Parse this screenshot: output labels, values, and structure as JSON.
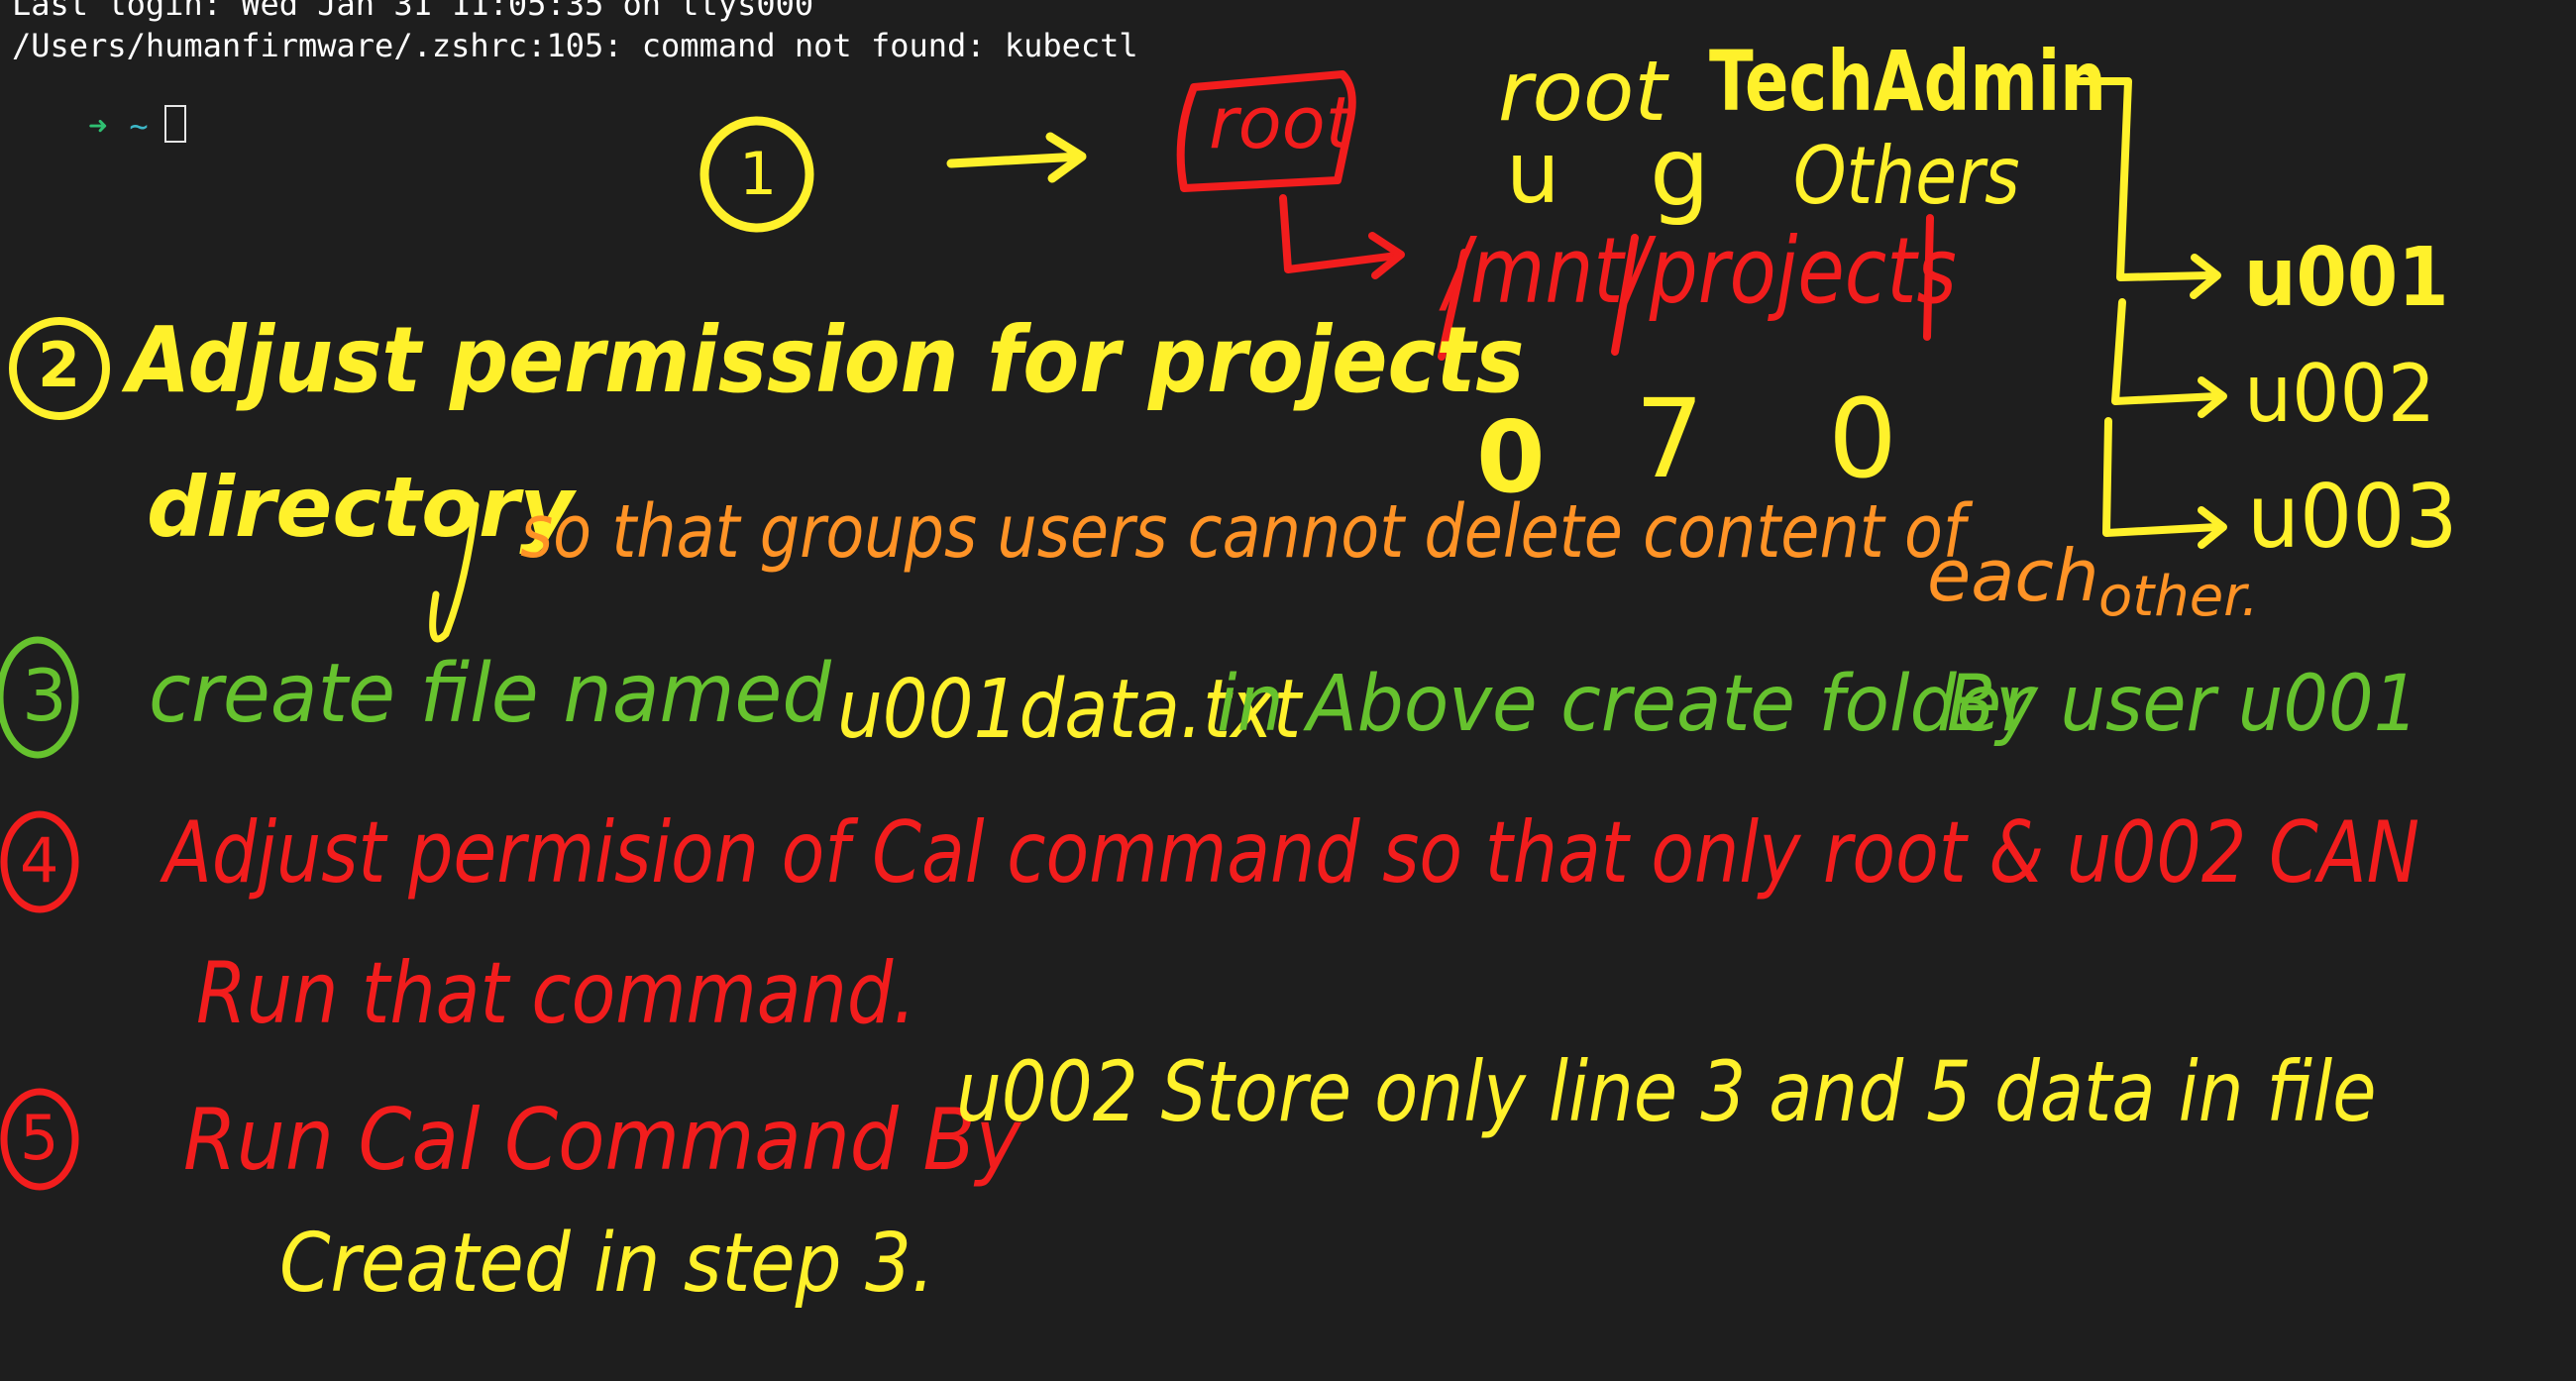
{
  "terminal": {
    "last_login": "Last login: Wed Jan 31 11:05:35 on ttys000",
    "error_line": "/Users/humanfirmware/.zshrc:105: command not found: kubectl",
    "prompt_arrow": "➜",
    "prompt_dir": "~"
  },
  "colors": {
    "background": "#1e1e1e",
    "yellow": "#fff12b",
    "orange": "#ff9326",
    "green": "#66c22e",
    "red": "#f21d1d",
    "prompt_green": "#2fbf71",
    "prompt_cyan": "#3db7c7"
  },
  "notes": {
    "step1": {
      "number": "1",
      "box_label": "root",
      "path": "/mnt/projects",
      "perm_header_owner": "root",
      "perm_header_group": "TechAdmin",
      "col_u": "u",
      "col_g": "g",
      "col_others": "Others",
      "perm_values": [
        "0",
        "7",
        "0"
      ],
      "users": [
        "u001",
        "u002",
        "u003"
      ]
    },
    "step2": {
      "number": "2",
      "line1": "Adjust permission for projects",
      "line2_start": "directory",
      "line2_rest": "so that groups users cannot delete content of",
      "each": "each",
      "other": "other."
    },
    "step3": {
      "number": "3",
      "text_a": "create file named",
      "filename": "u001data.txt",
      "text_b": "in Above create folder",
      "by_user": "By user u001"
    },
    "step4": {
      "number": "4",
      "line1": "Adjust permision of Cal command so that only root & u002 CAN",
      "line2": "Run that command."
    },
    "step5": {
      "number": "5",
      "text_a": "Run Cal Command By",
      "text_b": "u002 Store only line 3 and 5 data in file",
      "line2": "Created in step 3."
    }
  }
}
